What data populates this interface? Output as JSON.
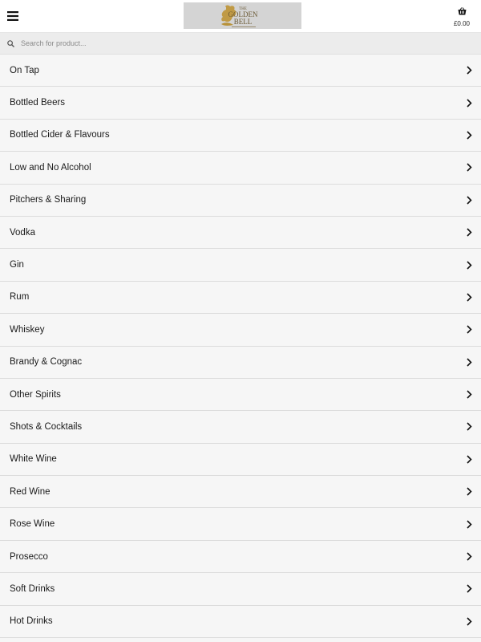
{
  "header": {
    "logo_text": [
      "THE",
      "GOLDEN",
      "BELL"
    ],
    "cart_total": "£0.00"
  },
  "search": {
    "placeholder": "Search for product..."
  },
  "categories": [
    {
      "label": "On Tap"
    },
    {
      "label": "Bottled Beers"
    },
    {
      "label": "Bottled Cider & Flavours"
    },
    {
      "label": "Low and No Alcohol"
    },
    {
      "label": "Pitchers & Sharing"
    },
    {
      "label": "Vodka"
    },
    {
      "label": "Gin"
    },
    {
      "label": "Rum"
    },
    {
      "label": "Whiskey"
    },
    {
      "label": "Brandy & Cognac"
    },
    {
      "label": "Other Spirits"
    },
    {
      "label": "Shots & Cocktails"
    },
    {
      "label": "White Wine"
    },
    {
      "label": "Red Wine"
    },
    {
      "label": "Rose Wine"
    },
    {
      "label": "Prosecco"
    },
    {
      "label": "Soft Drinks"
    },
    {
      "label": "Hot Drinks"
    }
  ],
  "icons": {
    "menu": "hamburger-menu-icon",
    "cart": "basket-icon",
    "search": "search-icon",
    "chevron": "chevron-right-icon"
  },
  "colors": {
    "logo_gold": "#b8923a",
    "logo_bg": "#d4d4d4"
  }
}
